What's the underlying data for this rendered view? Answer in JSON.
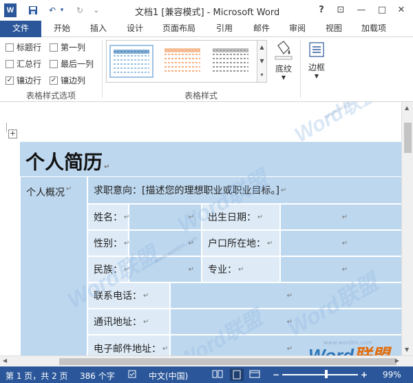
{
  "window": {
    "title": "文档1 [兼容模式] - Microsoft Word",
    "app_letter": "W",
    "help": "?",
    "restore": "⊡",
    "minimize": "—",
    "maximize": "□",
    "close": "✕"
  },
  "quick_access": {
    "save": "💾",
    "undo": "↶",
    "undo_more": "▾",
    "redo": "↻",
    "more": "⌄"
  },
  "tabs": [
    "文件",
    "开始",
    "插入",
    "设计",
    "页面布局",
    "引用",
    "邮件",
    "审阅",
    "视图",
    "加载项"
  ],
  "ribbon": {
    "options": {
      "header_row": "标题行",
      "first_col": "第一列",
      "total_row": "汇总行",
      "last_col": "最后一列",
      "banded_rows": "镶边行",
      "banded_cols": "镶边列",
      "group_label": "表格样式选项"
    },
    "styles": {
      "group_label": "表格样式"
    },
    "shading_label": "底纹",
    "borders_label": "边框",
    "colors": {
      "accent": "#2b579a",
      "style1": "#5b9bd5",
      "style2": "#ed7d31",
      "style3": "#555555"
    }
  },
  "doc": {
    "title": "个人简历",
    "section1": "个人概况",
    "objective": "求职意向：[描述您的理想职业或职业目标。]",
    "name": "姓名：",
    "birth": "出生日期：",
    "gender": "性别：",
    "hukou": "户口所在地：",
    "ethnic": "民族：",
    "major": "专业：",
    "phone": "联系电话：",
    "address": "通讯地址：",
    "email": "电子邮件地址：",
    "mark": "↵"
  },
  "watermarks": {
    "text1": "Word",
    "text2": "联盟",
    "site": "www.wordlm.com"
  },
  "status": {
    "page": "第 1 页，共 2 页",
    "words": "386 个字",
    "lang": "中文(中国)",
    "zoom": "99%",
    "zoom_minus": "−",
    "zoom_plus": "+"
  }
}
